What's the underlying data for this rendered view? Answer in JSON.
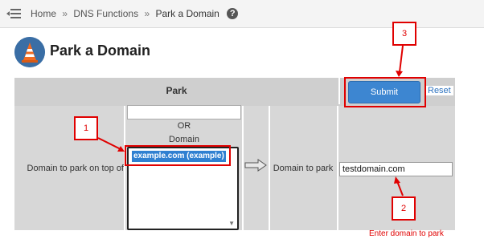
{
  "breadcrumb": {
    "home": "Home",
    "section": "DNS Functions",
    "current": "Park a Domain",
    "separator": "»",
    "help_glyph": "?"
  },
  "page": {
    "title": "Park a Domain"
  },
  "form": {
    "header_label": "Park",
    "left_label": "Domain to park on top of",
    "or_label": "OR",
    "domain_label": "Domain",
    "selected_option": "example.com (example)",
    "right_label": "Domain to park",
    "domain_input_value": "testdomain.com",
    "submit_label": "Submit",
    "reset_label": "Reset"
  },
  "annotations": {
    "step1": "1",
    "step2": "2",
    "step3": "3",
    "note2": "Enter domain to park"
  },
  "colors": {
    "accent": "#3d86d1",
    "annotation_red": "#e00000"
  }
}
